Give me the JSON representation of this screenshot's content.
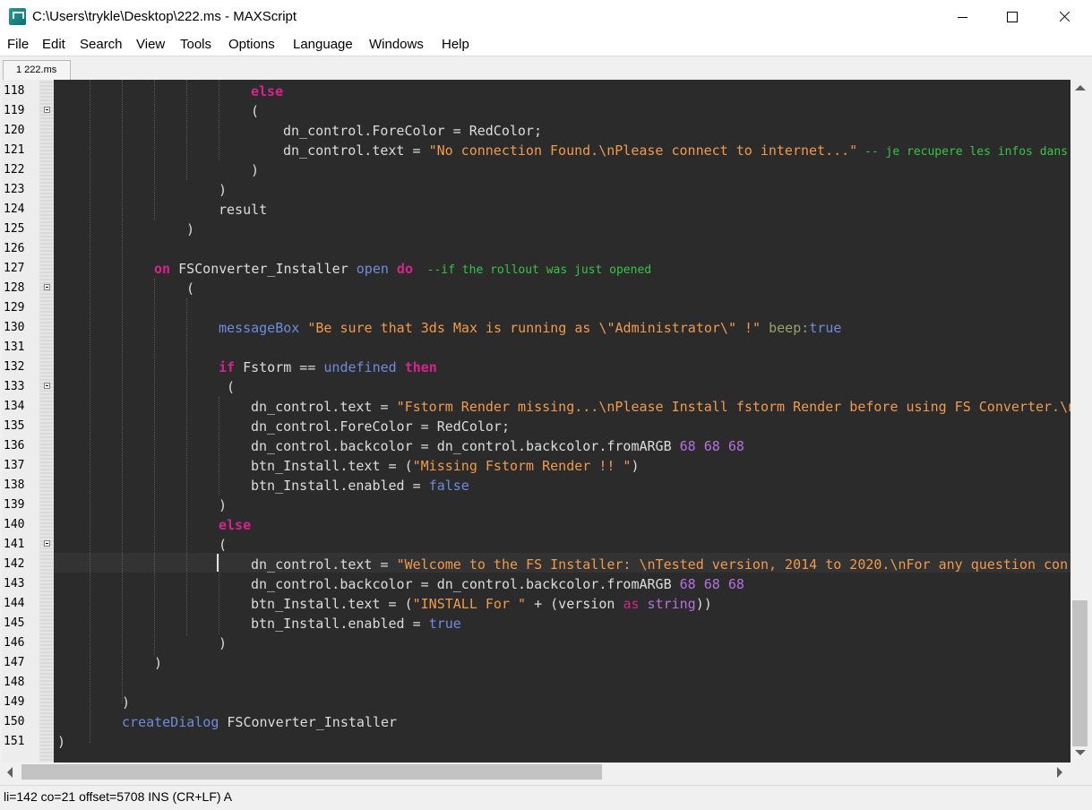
{
  "window": {
    "title": "C:\\Users\\trykle\\Desktop\\222.ms - MAXScript",
    "app_icon": "maxscript-app-icon"
  },
  "menu": [
    "File",
    "Edit",
    "Search",
    "View",
    "Tools",
    "Options",
    "Language",
    "Windows",
    "Help"
  ],
  "tab": {
    "label": "1 222.ms"
  },
  "editor": {
    "line_numbers": [
      "118",
      "119",
      "120",
      "121",
      "122",
      "123",
      "124",
      "125",
      "126",
      "127",
      "128",
      "129",
      "130",
      "131",
      "132",
      "133",
      "134",
      "135",
      "136",
      "137",
      "138",
      "139",
      "140",
      "141",
      "142",
      "143",
      "144",
      "145",
      "146",
      "147",
      "148",
      "149",
      "150",
      "151"
    ],
    "current_line": "142",
    "colors": {
      "background": "#2b2b2b",
      "keyword": "#d6238f",
      "builtin": "#6e8cde",
      "string": "#f09a4b",
      "comment": "#37c447",
      "number": "#b870e0"
    },
    "code": {
      "l118": {
        "kw": "else"
      },
      "l119": {
        "t": "("
      },
      "l120": {
        "t": "dn_control.ForeColor = RedColor;"
      },
      "l121": {
        "a": "dn_control.text = ",
        "s": "\"No connection Found.\\nPlease connect to internet...\"",
        "c": " -- je recupere les infos dans"
      },
      "l122": {
        "t": ")"
      },
      "l123": {
        "t": ")"
      },
      "l124": {
        "t": "result"
      },
      "l125": {
        "t": ")"
      },
      "l127": {
        "kw1": "on",
        "a": " FSConverter_Installer ",
        "b": "open",
        "kw2": " do",
        "c": "  --if the rollout was just opened"
      },
      "l128": {
        "t": "("
      },
      "l130": {
        "b": "messageBox",
        "s": " \"Be sure that 3ds Max is running as \\\"Administrator\\\" !\"",
        "p": " beep:",
        "b2": "true"
      },
      "l132": {
        "kw1": "if",
        "a": " Fstorm == ",
        "b": "undefined",
        "kw2": " then"
      },
      "l133": {
        "t": " ("
      },
      "l134": {
        "a": "dn_control.text = ",
        "s": "\"Fstorm Render missing...\\nPlease Install fstorm Render before using FS Converter.\\n"
      },
      "l135": {
        "t": "dn_control.ForeColor = RedColor;"
      },
      "l136": {
        "a": "dn_control.backcolor = dn_control.backcolor.fromARGB ",
        "n": "68 68 68"
      },
      "l137": {
        "a": "btn_Install.text = (",
        "s": "\"Missing Fstorm Render !! \"",
        "z": ")"
      },
      "l138": {
        "a": "btn_Install.enabled = ",
        "b": "false"
      },
      "l139": {
        "t": ")"
      },
      "l140": {
        "kw": "else"
      },
      "l141": {
        "t": "("
      },
      "l142": {
        "a": "dn_control.text = ",
        "s": "\"Welcome to the FS Installer: \\nTested version, 2014 to 2020.\\nFor any question con"
      },
      "l143": {
        "a": "dn_control.backcolor = dn_control.backcolor.fromARGB ",
        "n": "68 68 68"
      },
      "l144": {
        "a": "btn_Install.text = (",
        "s": "\"INSTALL For \"",
        "m": " + (version ",
        "kw": "as",
        "b": " string",
        "z": "))"
      },
      "l145": {
        "a": "btn_Install.enabled = ",
        "b": "true"
      },
      "l146": {
        "t": ")"
      },
      "l147": {
        "t": ")"
      },
      "l149": {
        "t": ")"
      },
      "l150": {
        "b": "createDialog",
        "a": " FSConverter_Installer"
      },
      "l151": {
        "t": ")"
      }
    }
  },
  "status": {
    "text": "li=142 co=21 offset=5708 INS (CR+LF) A"
  }
}
